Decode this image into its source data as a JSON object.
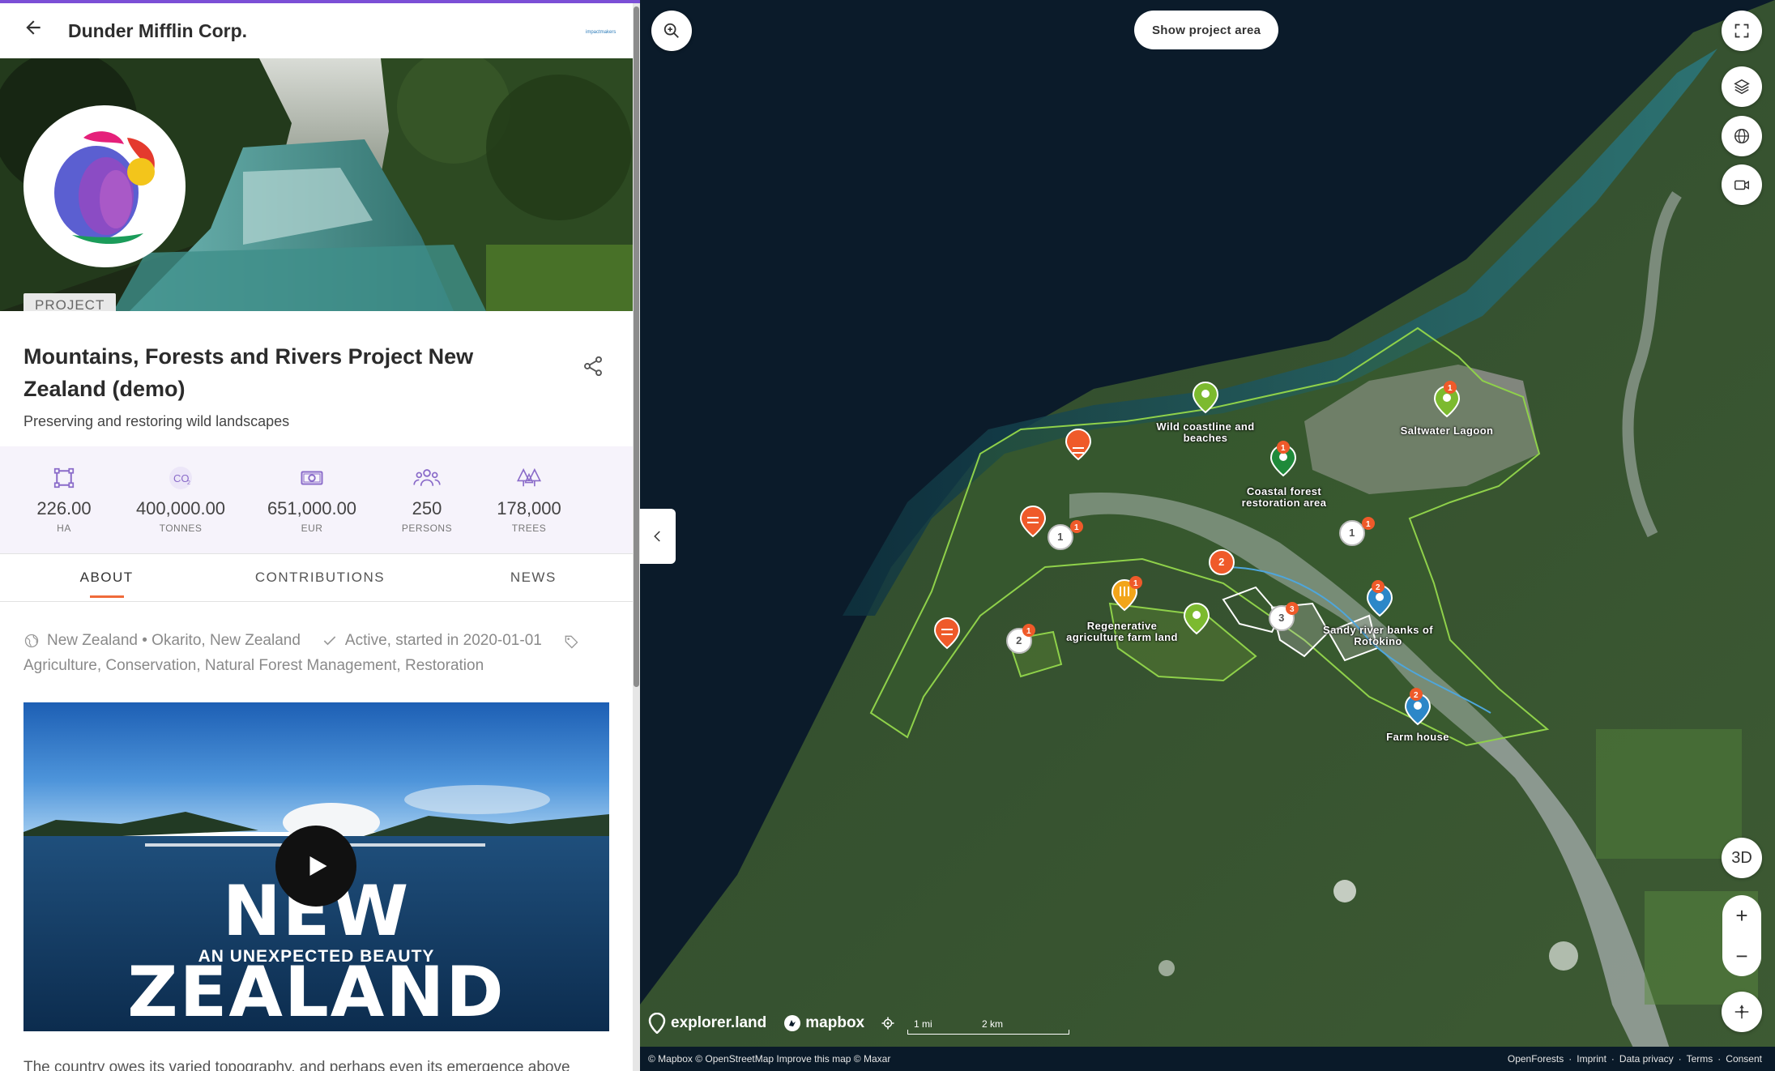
{
  "header": {
    "org_name": "Dunder Mifflin Corp.",
    "logo_text": "impactmakers"
  },
  "project": {
    "badge": "PROJECT",
    "title": "Mountains, Forests and Rivers Project New Zealand (demo)",
    "subtitle": "Preserving and restoring wild landscapes"
  },
  "stats": [
    {
      "icon": "area-icon",
      "value": "226.00",
      "unit": "HA"
    },
    {
      "icon": "co2-icon",
      "value": "400,000.00",
      "unit": "TONNES"
    },
    {
      "icon": "money-icon",
      "value": "651,000.00",
      "unit": "EUR"
    },
    {
      "icon": "persons-icon",
      "value": "250",
      "unit": "PERSONS"
    },
    {
      "icon": "trees-icon",
      "value": "178,000",
      "unit": "TREES"
    }
  ],
  "tabs": [
    {
      "label": "ABOUT",
      "active": true
    },
    {
      "label": "CONTRIBUTIONS",
      "active": false
    },
    {
      "label": "NEWS",
      "active": false
    }
  ],
  "meta": {
    "location": "New Zealand • Okarito, New Zealand",
    "status": "Active, started in 2020-01-01",
    "tags": "Agriculture, Conservation, Natural Forest Management, Restoration"
  },
  "video": {
    "title": "NEW ZEALAND",
    "subtitle": "AN UNEXPECTED BEAUTY"
  },
  "body_text": "The country owes its varied topography, and perhaps even its emergence above",
  "map": {
    "show_area_label": "Show project area",
    "three_d_label": "3D",
    "zoom_in": "+",
    "zoom_out": "−",
    "labels": {
      "wild_coastline": "Wild coastline and beaches",
      "saltwater_lagoon": "Saltwater Lagoon",
      "coastal_forest": "Coastal forest restoration area",
      "regenerative": "Regenerative agriculture farm land",
      "sandy_river": "Sandy river banks of Rotokino",
      "farm_house": "Farm house"
    },
    "cluster_counts": [
      "1",
      "1",
      "2",
      "2",
      "3"
    ],
    "badge_counts": [
      "1",
      "1",
      "1",
      "1",
      "2",
      "1",
      "3",
      "1",
      "2"
    ],
    "brand": {
      "explorer": "explorer.land",
      "mapbox": "mapbox"
    },
    "scale": {
      "mi": "1 mi",
      "km": "2 km"
    },
    "attribution": "© Mapbox © OpenStreetMap Improve this map © Maxar",
    "footer_links": [
      "OpenForests",
      "Imprint",
      "Data privacy",
      "Terms",
      "Consent"
    ],
    "footer_separators": "·"
  },
  "colors": {
    "accent": "#7b4fd6",
    "tab_underline": "#ef6a3a",
    "marker_orange": "#ef5a2a",
    "marker_green": "#7cba2f",
    "marker_blue": "#2c87c8"
  }
}
